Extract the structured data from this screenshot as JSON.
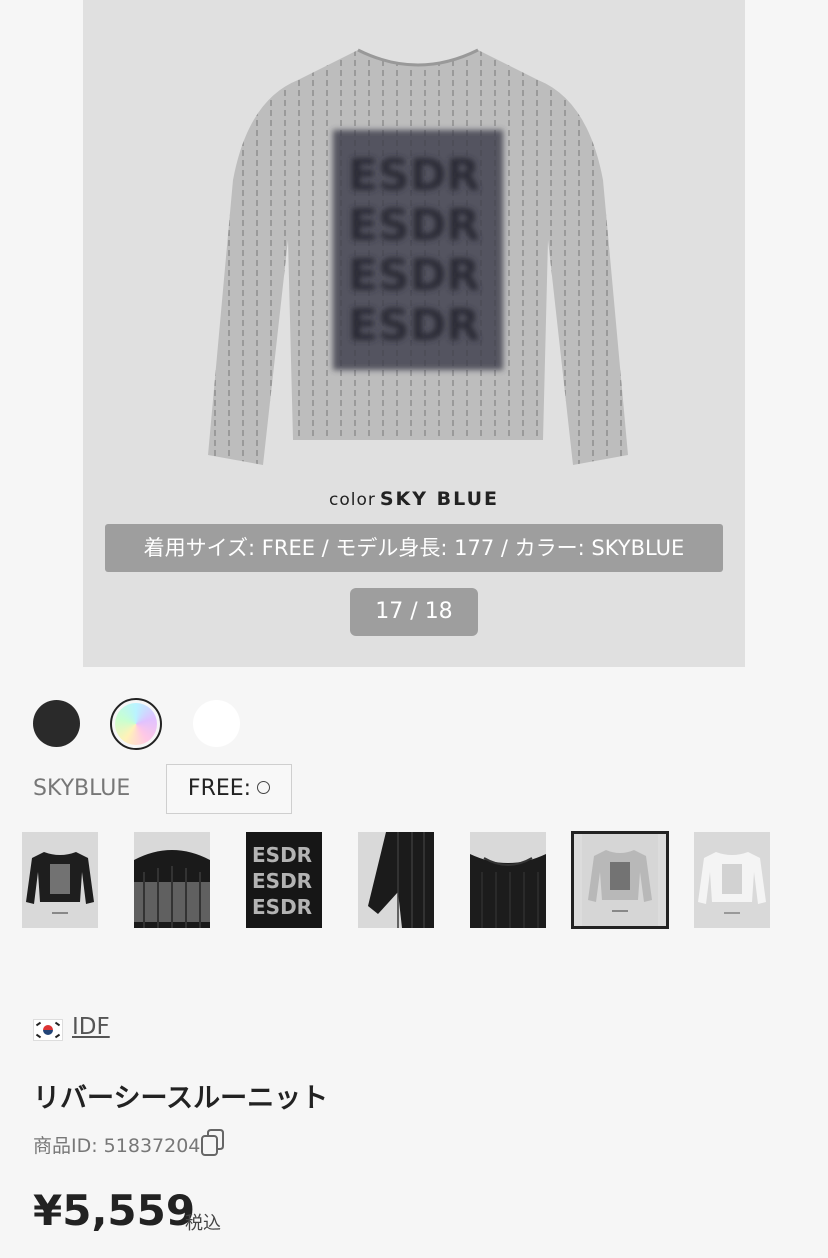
{
  "hero": {
    "color_caption_prefix": "color",
    "color_caption_name": "SKY BLUE",
    "spec_label": "着用サイズ: FREE / モデル身長: 177 / カラー: SKYBLUE",
    "counter": "17 / 18"
  },
  "swatches": [
    "black",
    "multi",
    "white"
  ],
  "size": {
    "selected_color": "SKYBLUE",
    "option_label": "FREE:"
  },
  "thumbnails": [
    {
      "name": "thumb-black-front"
    },
    {
      "name": "thumb-black-closeup"
    },
    {
      "name": "thumb-print-detail"
    },
    {
      "name": "thumb-sleeve-detail"
    },
    {
      "name": "thumb-black-neck"
    },
    {
      "name": "thumb-skyblue-front",
      "selected": true
    },
    {
      "name": "thumb-white-front"
    }
  ],
  "product": {
    "brand": "IDF",
    "title": "リバーシースルーニット",
    "product_id": "商品ID: 51837204",
    "price": "¥5,559",
    "tax_label": "税込"
  },
  "colors": {
    "background": "#f6f6f6",
    "hero_bg": "#e0e0e0",
    "overlay": "#9e9e9e"
  }
}
